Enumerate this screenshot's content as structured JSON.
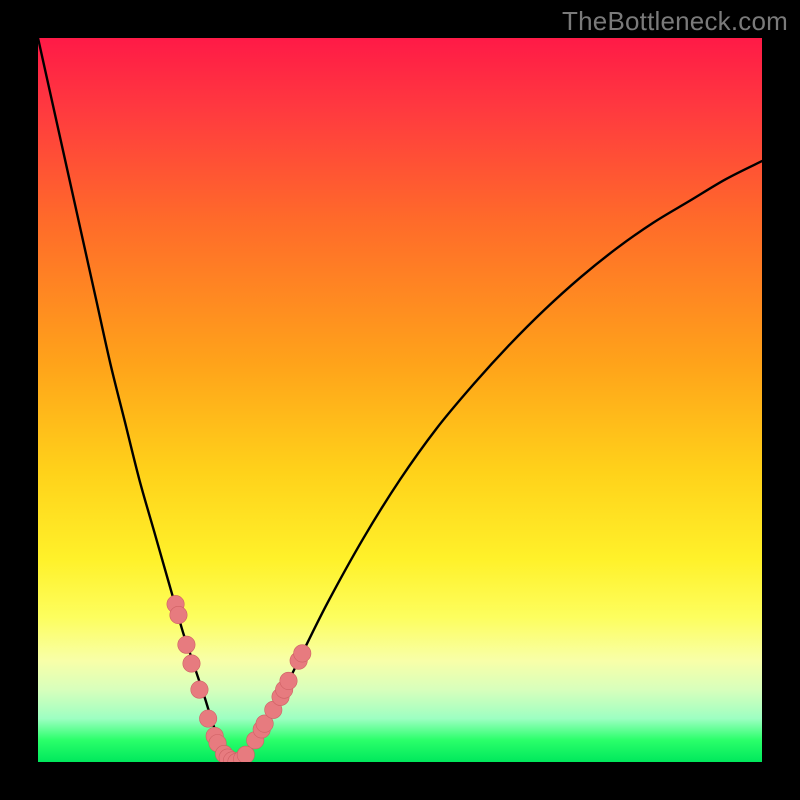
{
  "watermark": "TheBottleneck.com",
  "colors": {
    "background": "#000000",
    "curve": "#000000",
    "marker_fill": "#e77b7f",
    "marker_stroke": "#cf6064"
  },
  "chart_data": {
    "type": "line",
    "title": "",
    "xlabel": "",
    "ylabel": "",
    "xlim": [
      0,
      100
    ],
    "ylim": [
      0,
      100
    ],
    "grid": false,
    "legend": false,
    "series": [
      {
        "name": "bottleneck-curve",
        "x": [
          0,
          2,
          4,
          6,
          8,
          10,
          12,
          14,
          16,
          18,
          19,
          20,
          21,
          22,
          23,
          23.8,
          24.6,
          25.4,
          26.2,
          27,
          28,
          30,
          33,
          36,
          40,
          45,
          50,
          55,
          60,
          65,
          70,
          75,
          80,
          85,
          90,
          95,
          100
        ],
        "y": [
          100,
          91,
          82,
          73,
          64,
          55,
          47,
          39,
          32,
          25,
          21.5,
          18,
          15,
          12,
          9,
          6.4,
          4,
          2,
          0.8,
          0,
          0.6,
          3,
          8,
          14,
          22,
          31,
          39,
          46,
          52,
          57.5,
          62.5,
          67,
          71,
          74.5,
          77.5,
          80.5,
          83
        ]
      }
    ],
    "markers": [
      {
        "x": 19.0,
        "y": 21.8
      },
      {
        "x": 19.4,
        "y": 20.3
      },
      {
        "x": 20.5,
        "y": 16.2
      },
      {
        "x": 21.2,
        "y": 13.6
      },
      {
        "x": 22.3,
        "y": 10.0
      },
      {
        "x": 23.5,
        "y": 6.0
      },
      {
        "x": 24.4,
        "y": 3.6
      },
      {
        "x": 24.8,
        "y": 2.6
      },
      {
        "x": 25.7,
        "y": 1.1
      },
      {
        "x": 26.2,
        "y": 0.6
      },
      {
        "x": 26.8,
        "y": 0.2
      },
      {
        "x": 27.4,
        "y": 0.0
      },
      {
        "x": 28.2,
        "y": 0.4
      },
      {
        "x": 28.7,
        "y": 1.0
      },
      {
        "x": 30.0,
        "y": 3.0
      },
      {
        "x": 30.9,
        "y": 4.5
      },
      {
        "x": 31.3,
        "y": 5.3
      },
      {
        "x": 32.5,
        "y": 7.2
      },
      {
        "x": 33.5,
        "y": 9.0
      },
      {
        "x": 34.0,
        "y": 10.0
      },
      {
        "x": 34.6,
        "y": 11.2
      },
      {
        "x": 36.0,
        "y": 14.0
      },
      {
        "x": 36.5,
        "y": 15.0
      }
    ],
    "marker_radius_pct": 1.2
  }
}
